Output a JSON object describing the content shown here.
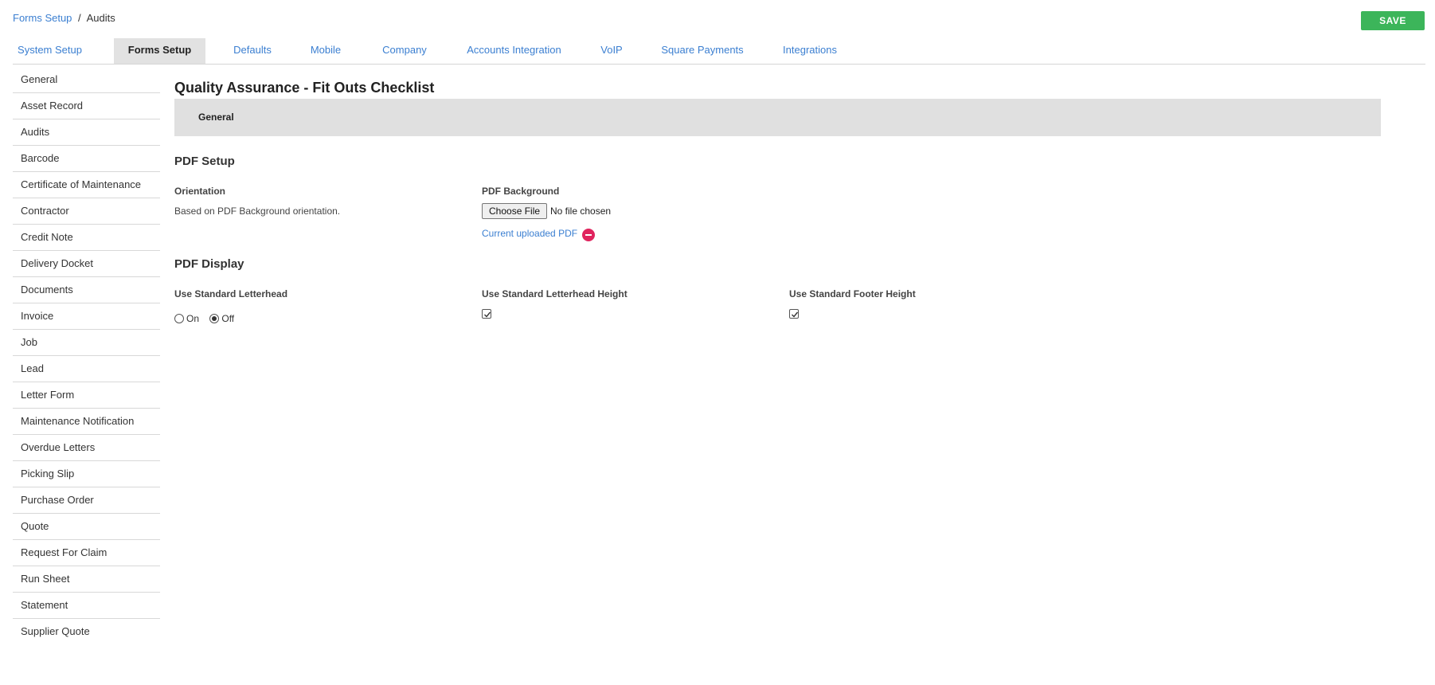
{
  "breadcrumb": {
    "parent": "Forms Setup",
    "separator": "/",
    "current": "Audits"
  },
  "header": {
    "save_label": "SAVE"
  },
  "tabs": [
    {
      "label": "System Setup",
      "active": false
    },
    {
      "label": "Forms Setup",
      "active": true
    },
    {
      "label": "Defaults",
      "active": false
    },
    {
      "label": "Mobile",
      "active": false
    },
    {
      "label": "Company",
      "active": false
    },
    {
      "label": "Accounts Integration",
      "active": false
    },
    {
      "label": "VoIP",
      "active": false
    },
    {
      "label": "Square Payments",
      "active": false
    },
    {
      "label": "Integrations",
      "active": false
    }
  ],
  "sidebar": {
    "items": [
      {
        "label": "General"
      },
      {
        "label": "Asset Record"
      },
      {
        "label": "Audits"
      },
      {
        "label": "Barcode"
      },
      {
        "label": "Certificate of Maintenance"
      },
      {
        "label": "Contractor"
      },
      {
        "label": "Credit Note"
      },
      {
        "label": "Delivery Docket"
      },
      {
        "label": "Documents"
      },
      {
        "label": "Invoice"
      },
      {
        "label": "Job"
      },
      {
        "label": "Lead"
      },
      {
        "label": "Letter Form"
      },
      {
        "label": "Maintenance Notification"
      },
      {
        "label": "Overdue Letters"
      },
      {
        "label": "Picking Slip"
      },
      {
        "label": "Purchase Order"
      },
      {
        "label": "Quote"
      },
      {
        "label": "Request For Claim"
      },
      {
        "label": "Run Sheet"
      },
      {
        "label": "Statement"
      },
      {
        "label": "Supplier Quote"
      }
    ]
  },
  "main": {
    "title": "Quality Assurance - Fit Outs Checklist",
    "section_tab": "General",
    "pdf_setup": {
      "heading": "PDF Setup",
      "orientation_label": "Orientation",
      "orientation_text": "Based on PDF Background orientation.",
      "background_label": "PDF Background",
      "choose_file_label": "Choose File",
      "file_status": "No file chosen",
      "current_pdf_link": "Current uploaded PDF"
    },
    "pdf_display": {
      "heading": "PDF Display",
      "letterhead_label": "Use Standard Letterhead",
      "letterhead_on": "On",
      "letterhead_off": "Off",
      "letterhead_selected": "Off",
      "letterhead_height_label": "Use Standard Letterhead Height",
      "letterhead_height_checked": true,
      "footer_height_label": "Use Standard Footer Height",
      "footer_height_checked": true
    }
  },
  "colors": {
    "accent_link": "#3b7fd1",
    "save_button": "#3cb55a",
    "remove_icon": "#e0245e",
    "section_bar": "#e0e0e0"
  }
}
